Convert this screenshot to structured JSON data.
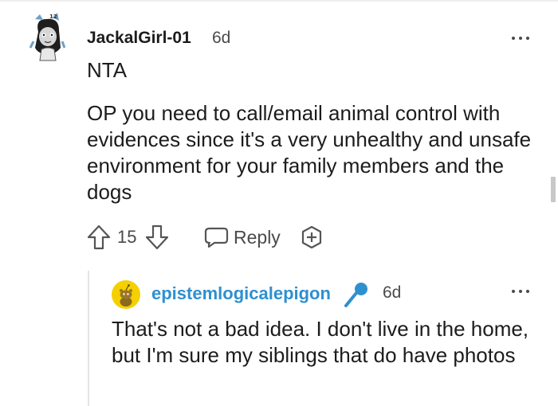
{
  "thread": {
    "comment": {
      "username": "JackalGirl-01",
      "timestamp": "6d",
      "headline": "NTA",
      "body": "OP you need to call/email animal control with evidences since it's a very unhealthy and unsafe environment for your family members and the dogs",
      "score": "15",
      "reply_label": "Reply"
    },
    "reply": {
      "username": "epistemlogicalepigon",
      "timestamp": "6d",
      "body": "That's not a bad idea. I don't live in the home, but I'm sure my siblings that do have photos"
    }
  },
  "colors": {
    "username_reply": "#2e90d0",
    "text": "#1c1c1c",
    "muted": "#4a4a4a",
    "snoo_avatar_bg": "#f5d000"
  },
  "icons": [
    "avatar",
    "more-icon",
    "upvote-icon",
    "downvote-icon",
    "reply-icon",
    "award-icon",
    "flair-microphone-icon"
  ]
}
